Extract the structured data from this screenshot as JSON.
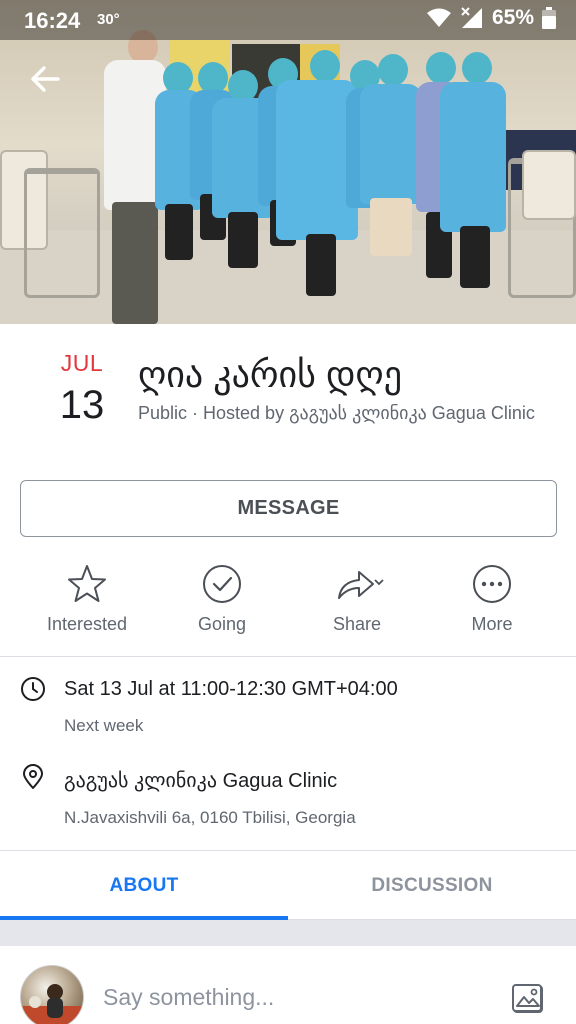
{
  "status_bar": {
    "time": "16:24",
    "temperature": "30°",
    "battery": "65%"
  },
  "header": {
    "back_icon": "back-arrow-icon"
  },
  "event": {
    "month": "JUL",
    "day": "13",
    "title": "ღია კარის დღე",
    "subtitle": "Public · Hosted by გაგუას კლინიკა   Gagua Clinic"
  },
  "buttons": {
    "message": "MESSAGE"
  },
  "actions": [
    {
      "label": "Interested",
      "icon": "star-icon"
    },
    {
      "label": "Going",
      "icon": "check-circle-icon"
    },
    {
      "label": "Share",
      "icon": "share-arrow-icon"
    },
    {
      "label": "More",
      "icon": "more-dots-icon"
    }
  ],
  "details": {
    "datetime": "Sat 13 Jul at 11:00-12:30 GMT+04:00",
    "relative": "Next week",
    "place_name": "გაგუას კლინიკა   Gagua Clinic",
    "address": "N.Javaxishvili 6a, 0160 Tbilisi, Georgia"
  },
  "tabs": {
    "about": "ABOUT",
    "discussion": "DISCUSSION",
    "active": "ABOUT"
  },
  "composer": {
    "placeholder": "Say something..."
  },
  "colors": {
    "accent": "#1877f2",
    "month": "#e0393e",
    "secondary_text": "#606770"
  }
}
